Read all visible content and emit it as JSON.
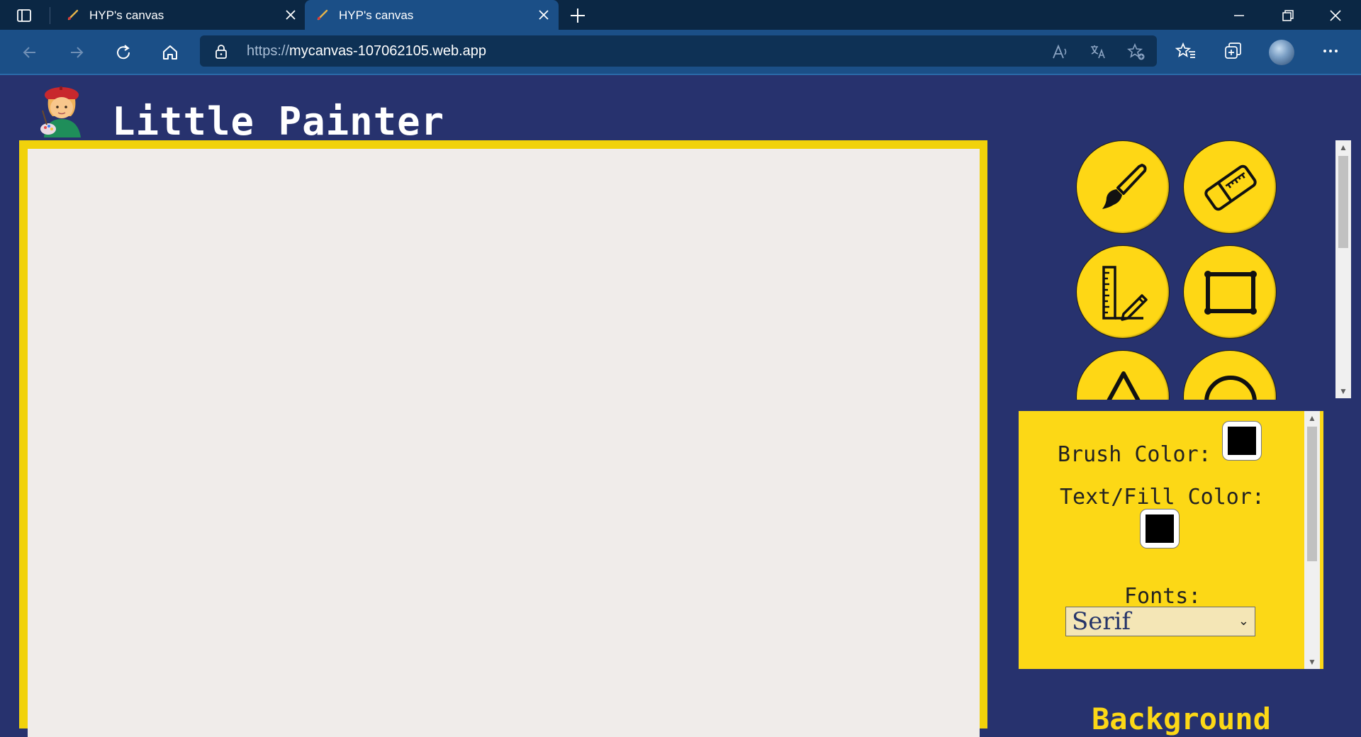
{
  "browser": {
    "tabs": [
      {
        "title": "HYP's canvas",
        "active": false
      },
      {
        "title": "HYP's canvas",
        "active": true
      }
    ],
    "url_protocol": "https://",
    "url_host": "mycanvas-107062105.web.app"
  },
  "app": {
    "title": "Little Painter",
    "logo_icon": "artist-emoji-icon"
  },
  "tools": [
    {
      "name": "brush",
      "icon": "paintbrush-icon"
    },
    {
      "name": "eraser",
      "icon": "eraser-icon"
    },
    {
      "name": "line",
      "icon": "ruler-pencil-icon"
    },
    {
      "name": "rectangle",
      "icon": "rectangle-icon"
    },
    {
      "name": "triangle",
      "icon": "triangle-icon"
    },
    {
      "name": "circle",
      "icon": "circle-icon"
    }
  ],
  "settings": {
    "brush_color_label": "Brush Color:",
    "brush_color": "#000000",
    "fill_color_label": "Text/Fill Color:",
    "fill_color": "#000000",
    "fonts_label": "Fonts:",
    "font_selected": "Serif"
  },
  "background_heading": "Background",
  "colors": {
    "page_bg": "#27326e",
    "accent_yellow": "#fcd816",
    "canvas_bg": "#f0ecea"
  }
}
